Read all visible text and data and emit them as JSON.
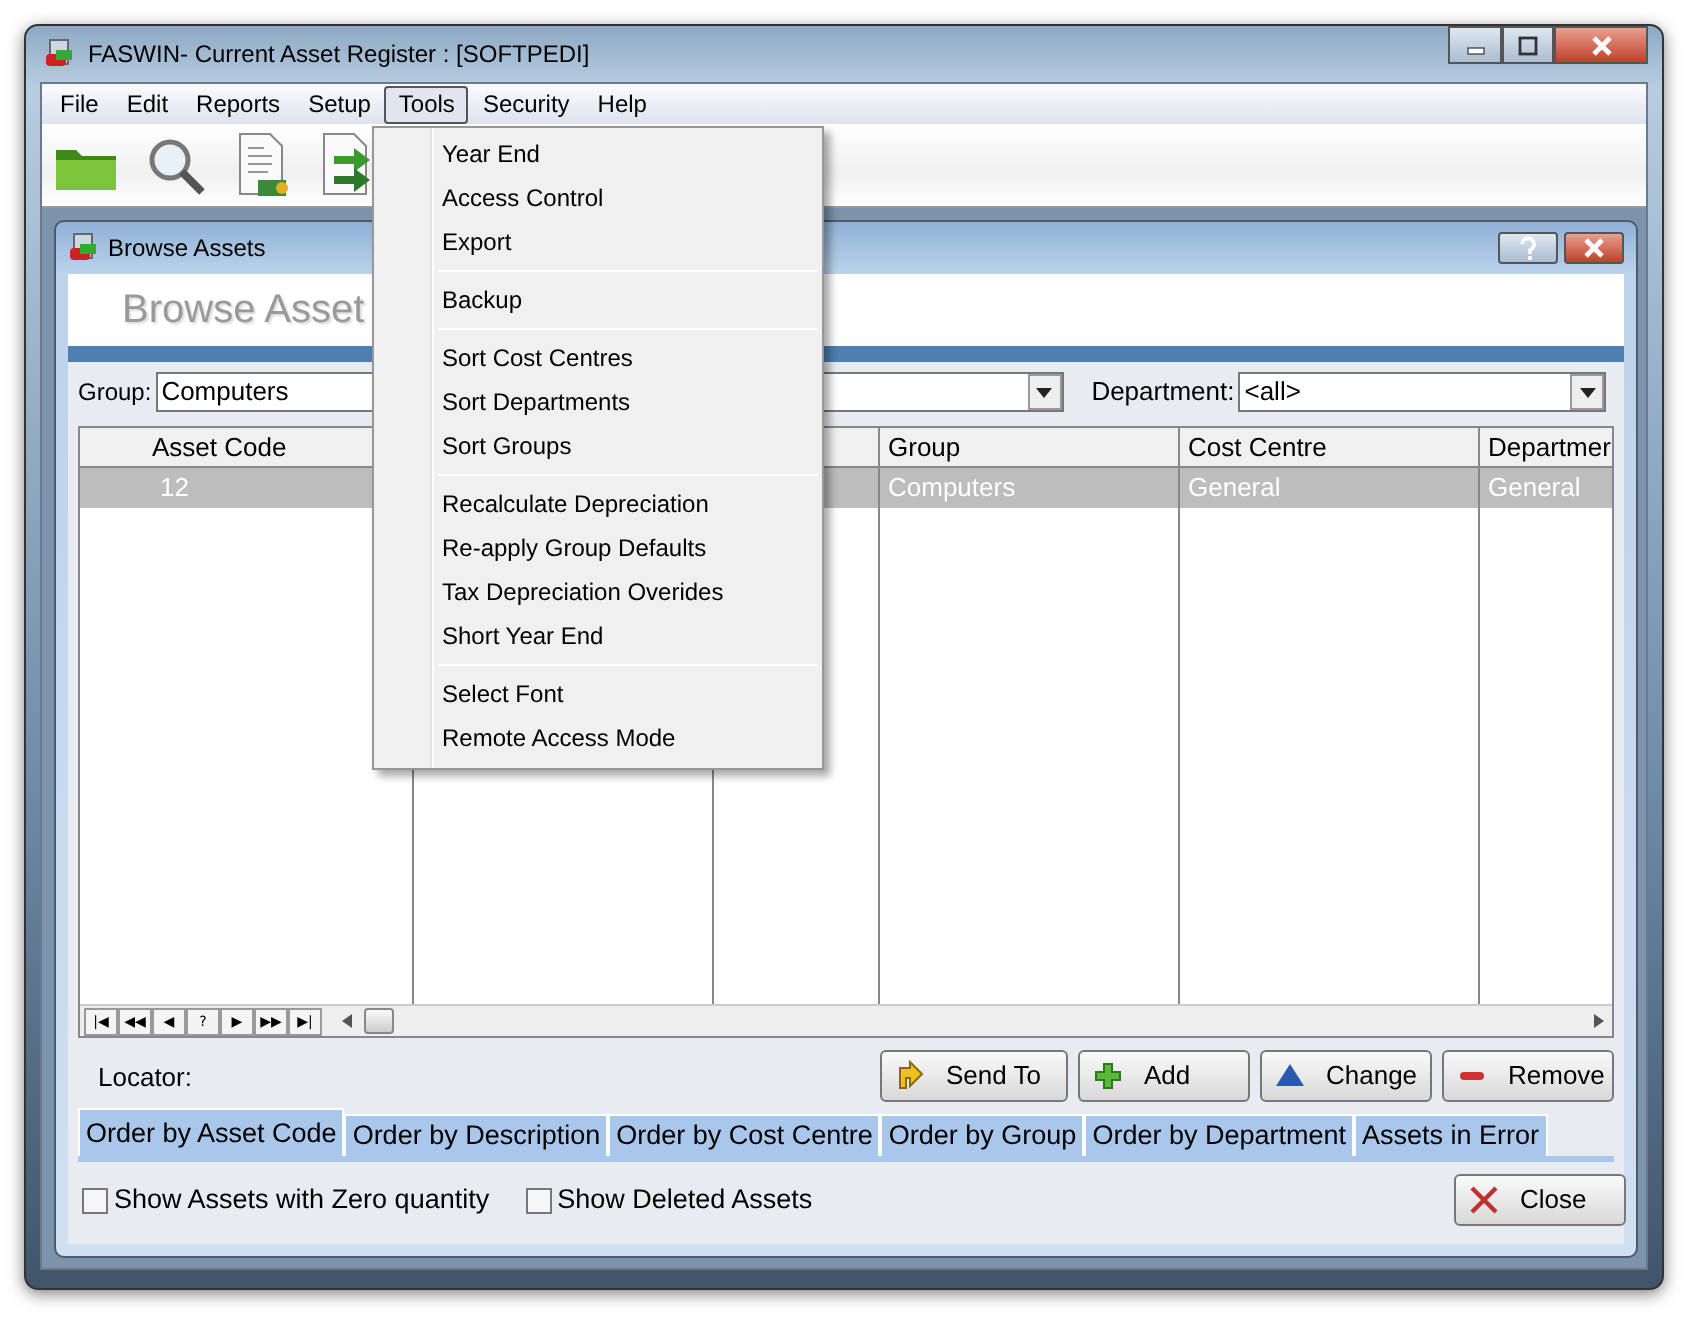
{
  "window": {
    "title": "FASWIN- Current Asset Register : [SOFTPEDI]"
  },
  "menu_bar": [
    {
      "label": "File",
      "selected": false
    },
    {
      "label": "Edit",
      "selected": false
    },
    {
      "label": "Reports",
      "selected": false
    },
    {
      "label": "Setup",
      "selected": false
    },
    {
      "label": "Tools",
      "selected": true
    },
    {
      "label": "Security",
      "selected": false
    },
    {
      "label": "Help",
      "selected": false
    }
  ],
  "tools_menu": {
    "groups": [
      [
        "Year End",
        "Access Control",
        "Export"
      ],
      [
        "Backup"
      ],
      [
        "Sort Cost Centres",
        "Sort Departments",
        "Sort Groups"
      ],
      [
        "Recalculate Depreciation",
        "Re-apply Group Defaults",
        "Tax Depreciation Overides",
        "Short Year End"
      ],
      [
        "Select Font",
        "Remote Access Mode"
      ]
    ]
  },
  "browse_window": {
    "title": "Browse Assets",
    "heading": "Browse Asset",
    "filters": {
      "group_label": "Group:",
      "group_value": "Computers",
      "department_label": "Department:",
      "department_value": "<all>"
    },
    "table": {
      "columns": [
        "Asset Code",
        null,
        null,
        "Group",
        "Cost Centre",
        "Departmer"
      ],
      "rows": [
        {
          "selected": true,
          "cells": [
            "12",
            null,
            null,
            "Computers",
            "General",
            "General"
          ]
        }
      ]
    },
    "navigator": [
      "|◀",
      "◀◀",
      "◀",
      "?",
      "▶",
      "▶▶",
      "▶|"
    ],
    "locator_label": "Locator:",
    "actions": [
      {
        "kind": "send",
        "label": "Send To"
      },
      {
        "kind": "add",
        "label": "Add"
      },
      {
        "kind": "change",
        "label": "Change"
      },
      {
        "kind": "remove",
        "label": "Remove"
      }
    ],
    "order_tabs": [
      {
        "label": "Order by Asset Code",
        "selected": true
      },
      {
        "label": "Order by Description",
        "selected": false
      },
      {
        "label": "Order by Cost Centre",
        "selected": false
      },
      {
        "label": "Order by Group",
        "selected": false
      },
      {
        "label": "Order by Department",
        "selected": false
      },
      {
        "label": "Assets in Error",
        "selected": false
      }
    ],
    "options": [
      {
        "label": "Show Assets with Zero quantity",
        "checked": false
      },
      {
        "label": "Show Deleted Assets",
        "checked": false
      }
    ],
    "close_button": {
      "label": "Close"
    }
  }
}
